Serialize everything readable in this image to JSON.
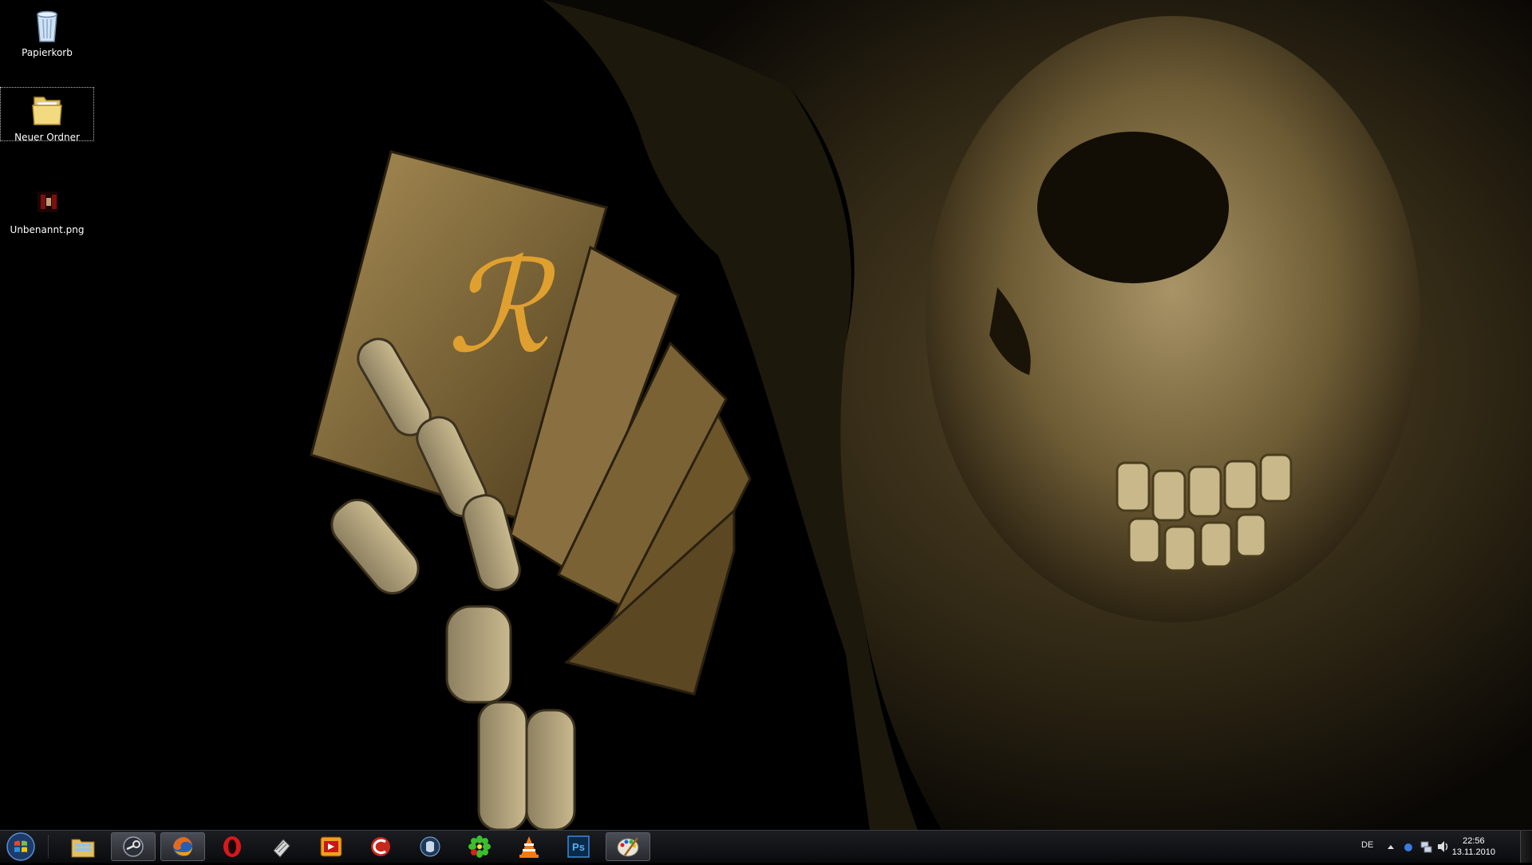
{
  "desktop": {
    "icons": [
      {
        "label": "Papierkorb",
        "icon": "recycle-bin-icon"
      },
      {
        "label": "Neuer Ordner",
        "icon": "folder-icon"
      },
      {
        "label": "Unbenannt.png",
        "icon": "image-file-icon"
      }
    ]
  },
  "taskbar": {
    "start": {
      "icon": "windows-start-icon"
    },
    "apps": [
      {
        "icon": "explorer-icon",
        "active": false
      },
      {
        "icon": "steam-icon",
        "active": true
      },
      {
        "icon": "firefox-icon",
        "active": true
      },
      {
        "icon": "opera-icon",
        "active": false
      },
      {
        "icon": "utility-icon",
        "active": false
      },
      {
        "icon": "media-app-icon",
        "active": false
      },
      {
        "icon": "ccleaner-icon",
        "active": false
      },
      {
        "icon": "teamspeak-icon",
        "active": false
      },
      {
        "icon": "icq-icon",
        "active": false
      },
      {
        "icon": "vlc-icon",
        "active": false
      },
      {
        "icon": "photoshop-icon",
        "active": false
      },
      {
        "icon": "paint-icon",
        "active": true
      }
    ],
    "tray": {
      "language": "DE",
      "time": "22:56",
      "date": "13.11.2010"
    },
    "photoshop_label": "Ps"
  }
}
